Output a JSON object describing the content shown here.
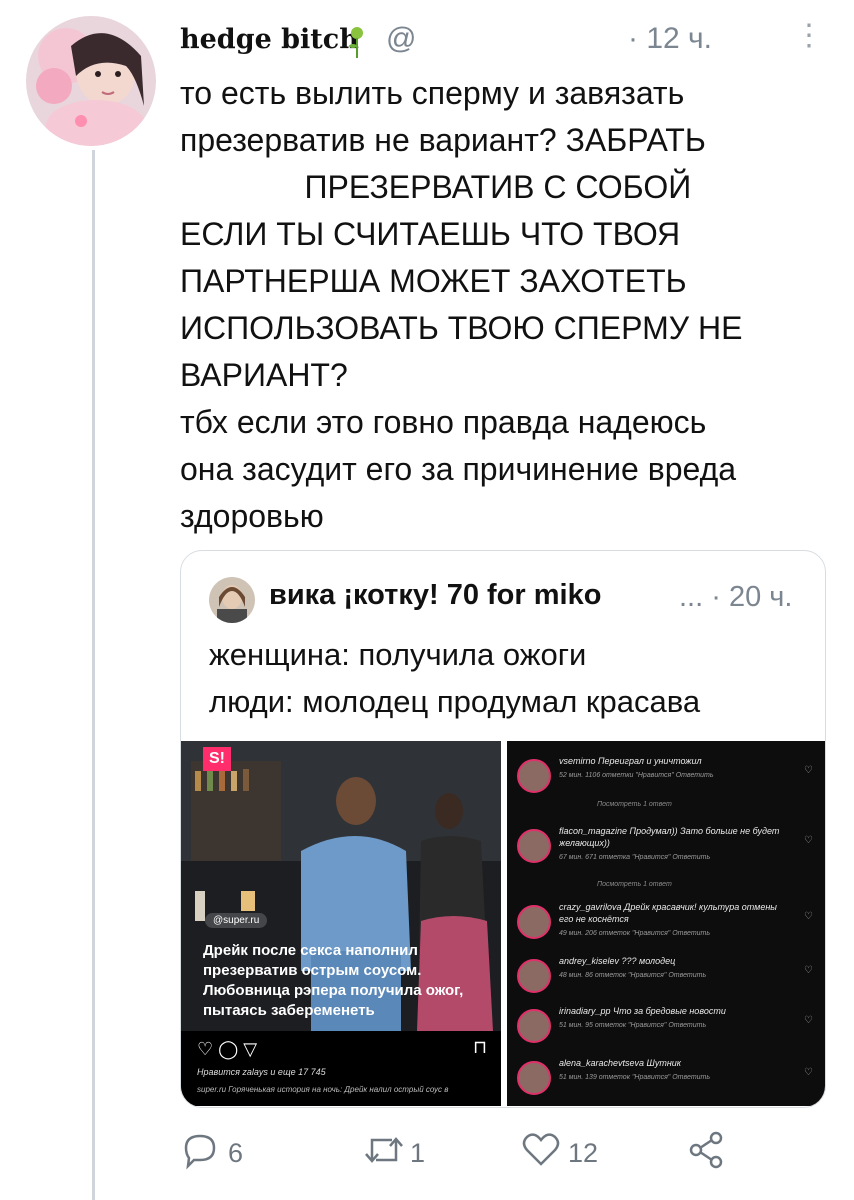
{
  "tweet": {
    "username": "hedge bitch",
    "handle": "@",
    "time": "· 12 ч.",
    "more": "⋮",
    "text": [
      "то есть вылить сперму и завязать",
      "презерватив не вариант? ЗАБРАТЬ",
      "              ПРЕЗЕРВАТИВ С СОБОЙ",
      "ЕСЛИ ТЫ СЧИТАЕШЬ ЧТО ТВОЯ",
      "ПАРТНЕРША МОЖЕТ ЗАХОТЕТЬ",
      "ИСПОЛЬЗОВАТЬ ТВОЮ СПЕРМУ НЕ",
      "ВАРИАНТ?",
      "тбх если это говно правда надеюсь",
      "она засудит его за причинение вреда",
      "здоровью"
    ]
  },
  "quote": {
    "name": "вика ¡котку! 70 for miko",
    "meta": "... · 20 ч.",
    "text": [
      "женщина: получила ожоги",
      "люди: молодец продумал красава"
    ],
    "left_media": {
      "badge": "S!",
      "source": "@super.ru",
      "headline": "Дрейк после секса наполнил презерватив острым соусом. Любовница рэпера получила ожог, пытаясь забеременеть",
      "icons": "♡  ◯  ▽",
      "bookmark": "⊓",
      "likes": "Нравится zalays и еще 17 745",
      "caption": "super.ru Горяченькая история на ночь: Дрейк налил острый соус в"
    },
    "comments": [
      {
        "user": "vsemirno Переиграл и уничтожил",
        "meta": "52 мин.   1106 отметки \"Нравится\"   Ответить"
      },
      {
        "user": "flacon_magazine Продумал)) Зато больше не будет желающих))",
        "meta": "67 мин.   671 отметка \"Нравится\"   Ответить"
      },
      {
        "user": "crazy_gavrilova Дрейк красавчик! культура отмены его не коснётся",
        "meta": "49 мин.   206 отметок \"Нравится\"   Ответить"
      },
      {
        "user": "andrey_kiselev ??? молодец",
        "meta": "48 мин.   86 отметок \"Нравится\"   Ответить"
      },
      {
        "user": "irinadiary_pp Что за бредовые новости",
        "meta": "51 мин.   95 отметок \"Нравится\"   Ответить"
      },
      {
        "user": "alena_karachevtseva Шутник",
        "meta": "51 мин.   139 отметок \"Нравится\"   Ответить"
      }
    ],
    "replies_label": "Посмотреть 1 ответ"
  },
  "actions": {
    "replies": "6",
    "retweets": "1",
    "likes": "12"
  },
  "colors": {
    "muted": "#7b8690",
    "thread_line": "#cfd5da",
    "badge": "#ff2d6b"
  }
}
